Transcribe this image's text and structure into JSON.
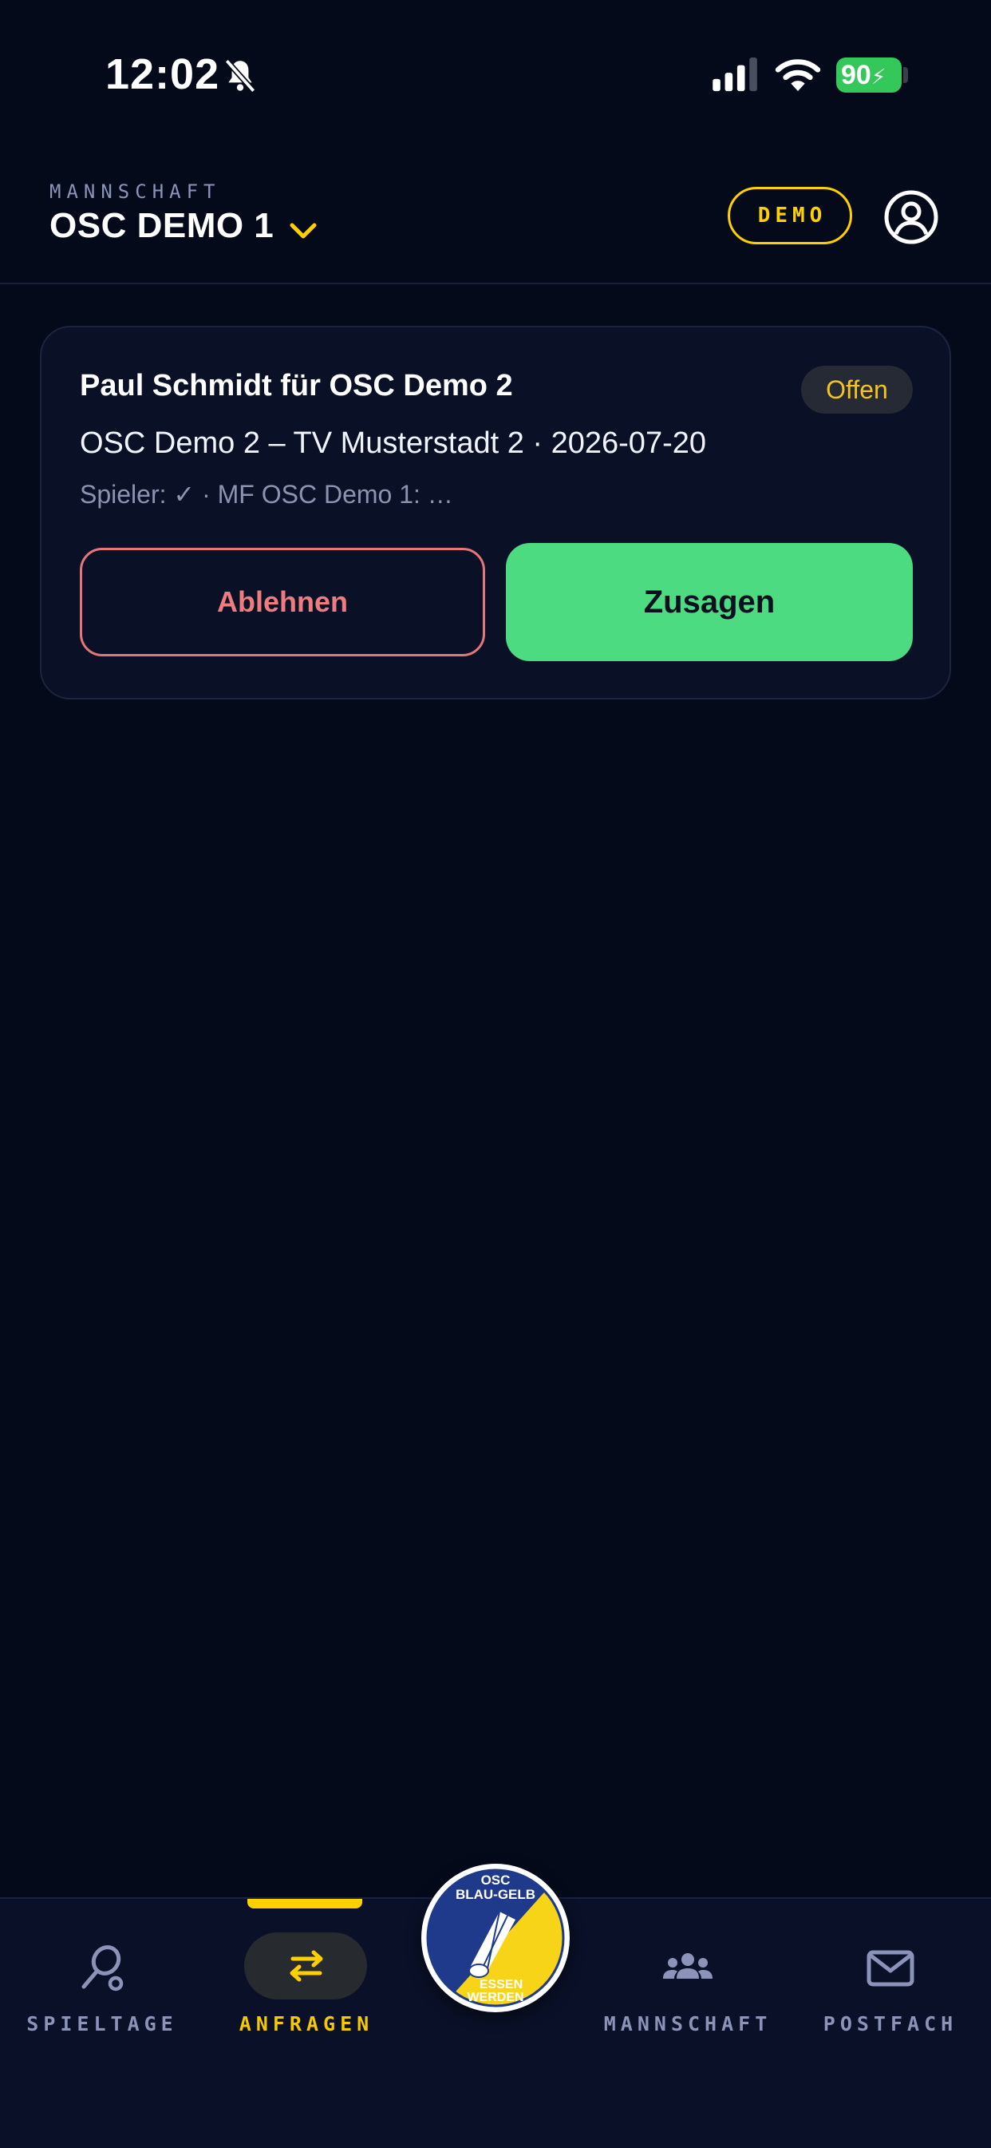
{
  "status_bar": {
    "time": "12:02",
    "battery": "90"
  },
  "header": {
    "label": "MANNSCHAFT",
    "team": "OSC DEMO 1",
    "mode_badge": "DEMO"
  },
  "request_card": {
    "title": "Paul Schmidt für OSC Demo 2",
    "status": "Offen",
    "match": "OSC Demo 2 – TV Musterstadt 2 · 2026-07-20",
    "meta": "Spieler: ✓ · MF OSC Demo 1: …",
    "decline_label": "Ablehnen",
    "accept_label": "Zusagen"
  },
  "nav": {
    "items": [
      {
        "label": "SPIELTAGE"
      },
      {
        "label": "ANFRAGEN"
      },
      {
        "label": "MANNSCHAFT"
      },
      {
        "label": "POSTFACH"
      }
    ],
    "logo": {
      "line1": "OSC",
      "line2": "BLAU-GELB",
      "line3": "ESSEN",
      "line4": "WERDEN"
    }
  },
  "colors": {
    "background": "#050a1b",
    "accent": "#ffd000",
    "accept": "#4cdb80",
    "decline": "#ee7c7e"
  }
}
